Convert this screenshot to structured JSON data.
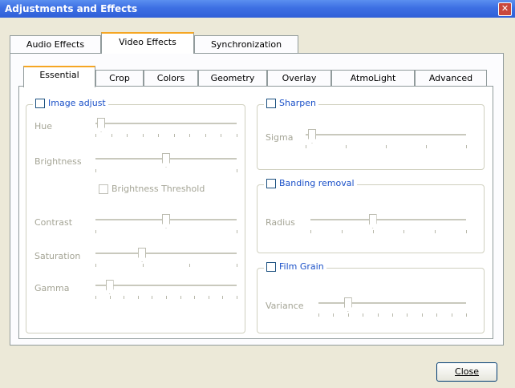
{
  "window": {
    "title": "Adjustments and Effects"
  },
  "top_tabs": [
    "Audio Effects",
    "Video Effects",
    "Synchronization"
  ],
  "inner_tabs": [
    "Essential",
    "Crop",
    "Colors",
    "Geometry",
    "Overlay",
    "AtmoLight",
    "Advanced"
  ],
  "image_adjust": {
    "title": "Image adjust",
    "hue": "Hue",
    "brightness": "Brightness",
    "threshold": "Brightness Threshold",
    "contrast": "Contrast",
    "saturation": "Saturation",
    "gamma": "Gamma",
    "levels": {
      "hue": 0.04,
      "brightness": 0.5,
      "contrast": 0.5,
      "saturation": 0.33,
      "gamma": 0.1
    }
  },
  "sharpen": {
    "title": "Sharpen",
    "sigma": "Sigma",
    "level": 0.04
  },
  "banding": {
    "title": "Banding removal",
    "radius": "Radius",
    "level": 0.4
  },
  "film_grain": {
    "title": "Film Grain",
    "variance": "Variance",
    "level": 0.2
  },
  "buttons": {
    "close": "Close"
  }
}
